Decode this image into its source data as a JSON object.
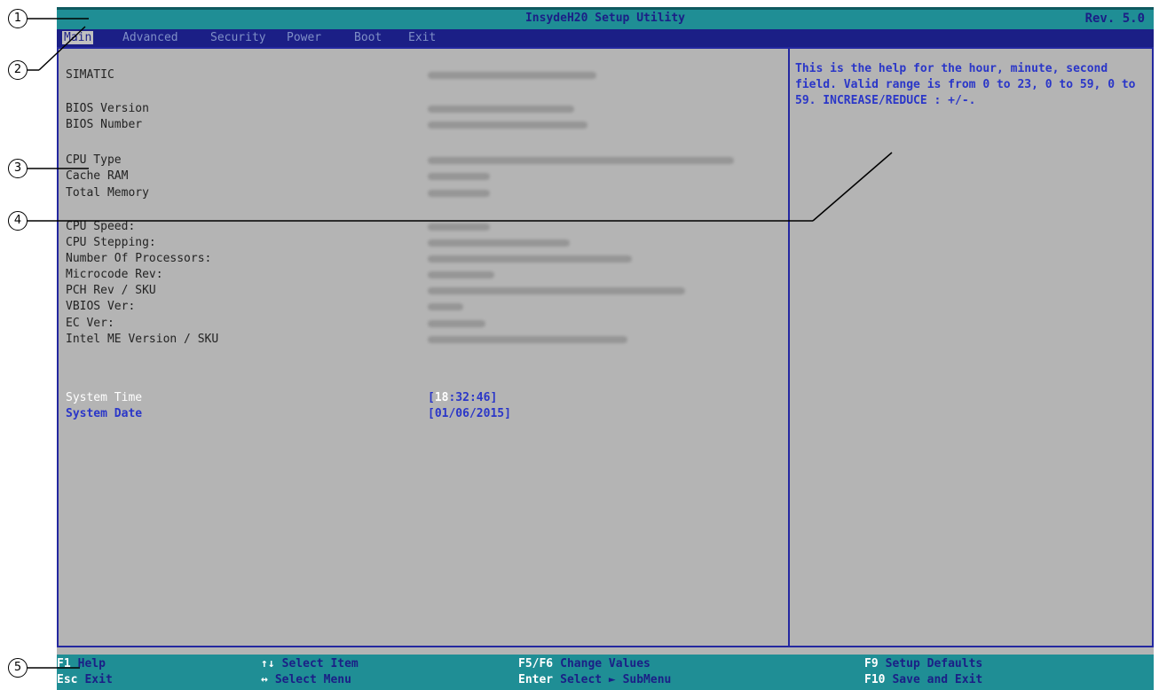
{
  "title_bar": {
    "title": "InsydeH20 Setup Utility",
    "rev": "Rev. 5.0"
  },
  "menu": [
    {
      "label": "Main",
      "active": true
    },
    {
      "label": "Advanced"
    },
    {
      "label": "Security"
    },
    {
      "label": "Power"
    },
    {
      "label": "Boot"
    },
    {
      "label": "Exit"
    }
  ],
  "info_rows": [
    {
      "label": "SIMATIC"
    },
    {
      "label": "BIOS Version"
    },
    {
      "label": "BIOS Number"
    },
    {
      "label": "CPU Type"
    },
    {
      "label": "Cache RAM"
    },
    {
      "label": "Total Memory"
    },
    {
      "label": "CPU Speed:"
    },
    {
      "label": "CPU Stepping:"
    },
    {
      "label": "Number Of Processors:"
    },
    {
      "label": "Microcode Rev:"
    },
    {
      "label": "PCH Rev / SKU"
    },
    {
      "label": "VBIOS Ver:"
    },
    {
      "label": "EC Ver:"
    },
    {
      "label": "Intel ME Version / SKU"
    }
  ],
  "system_time": {
    "label": "System Time",
    "open": "[",
    "hour": "18",
    "rest": ":32:46]"
  },
  "system_date": {
    "label": "System Date",
    "value": "[01/06/2015]"
  },
  "help_text": "This is the help for the hour, minute, second field. Valid range is from 0 to 23, 0 to 59, 0 to 59. INCREASE/REDUCE : +/-.",
  "footer": [
    {
      "key": "F1",
      "desc": "Help"
    },
    {
      "key": "Esc",
      "desc": "Exit"
    },
    {
      "key": "↑↓",
      "desc": "Select Item"
    },
    {
      "key": "↔",
      "desc": "Select Menu"
    },
    {
      "key": "F5/F6",
      "desc": "Change Values"
    },
    {
      "key": "Enter",
      "desc": "Select ► SubMenu"
    },
    {
      "key": "F9",
      "desc": "Setup Defaults"
    },
    {
      "key": "F10",
      "desc": "Save and Exit"
    }
  ],
  "callouts": [
    "1",
    "2",
    "3",
    "4",
    "5"
  ]
}
